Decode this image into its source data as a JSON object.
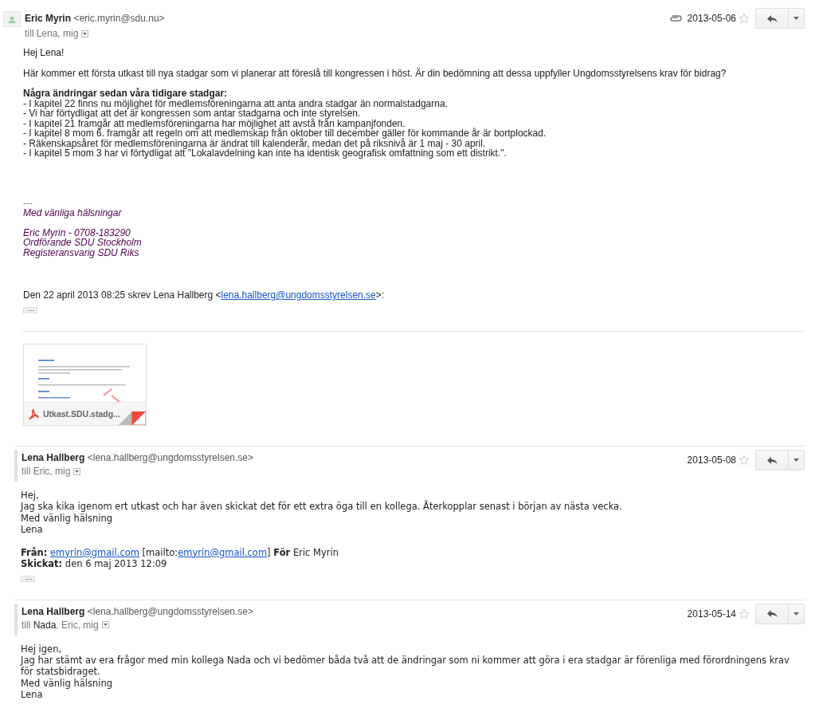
{
  "messages": [
    {
      "avatar_loaded": true,
      "sender_name": "Eric Myrin",
      "sender_email": "<eric.myrin@sdu.nu>",
      "recipients": [
        {
          "text": "till Lena, mig",
          "dark": false
        }
      ],
      "has_attachment": true,
      "date": "2013-05-06",
      "starred": false,
      "body": [
        {
          "kind": "paragraph",
          "lines": [
            "Hej Lena!"
          ]
        },
        {
          "kind": "paragraph",
          "lines": [
            "Här kommer ett första utkast till nya stadgar som vi planerar att föreslå till kongressen i höst. Är din bedömning att dessa uppfyller Ungdomsstyrelsens krav för bidrag?"
          ]
        },
        {
          "kind": "list",
          "heading": "Några ändringar sedan våra tidigare stadgar:",
          "items": [
            "- I kapitel 22 finns nu möjlighet för medlemsföreningarna att anta andra stadgar än normalstadgarna.",
            "- Vi har förtydligat att det är kongressen som antar stadgarna och inte styrelsen.",
            "- I kapitel 21 framgår att medlemsföreningarna har möjlighet att avstå från kampanjfonden.",
            "- I kapitel 8 mom 6. framgår att regeln om att medlemskap från oktober till december gäller för kommande år är bortplockad.",
            "- Räkenskapsåret för medlemsföreningarna är ändrat till kalenderår, medan det på riksnivå är 1 maj - 30 april.",
            "- I kapitel 5 mom 3 har vi förtydligat att \"Lokalavdelning kan inte ha identisk geografisk omfattning som ett distrikt.\"."
          ]
        },
        {
          "kind": "signature",
          "dash": "---",
          "groups": [
            [
              "Med vänliga hälsningar"
            ],
            [
              "Eric Myrin - 0708-183290",
              "Ordförande SDU Stockholm",
              "Registeransvarig SDU Riks"
            ]
          ]
        },
        {
          "kind": "quote",
          "before": "Den 22 april 2013 08:25 skrev Lena Hallberg <",
          "link": "lena.hallberg@ungdomsstyrelsen.se",
          "after": ">:"
        },
        {
          "kind": "ellipsis"
        },
        {
          "kind": "rule"
        },
        {
          "kind": "attachment",
          "name": "Utkast.SDU.stadg..."
        }
      ]
    },
    {
      "avatar_loaded": false,
      "sender_name": "Lena Hallberg",
      "sender_email": "<lena.hallberg@ungdomsstyrelsen.se>",
      "recipients": [
        {
          "text": "till Eric, mig",
          "dark": false
        }
      ],
      "has_attachment": false,
      "date": "2013-05-08",
      "starred": false,
      "body": [
        {
          "kind": "plain",
          "lines": [
            "Hej,",
            "Jag ska kika igenom ert utkast och har även skickat det för ett extra öga till en kollega. Återkopplar senast i början av nästa vecka.",
            "Med vänlig hälsning",
            "Lena"
          ]
        },
        {
          "kind": "from_header",
          "label": "Från:",
          "link1": "emyrin@gmail.com",
          "mid": " [mailto:",
          "link2": "emyrin@gmail.com",
          "end": "] ",
          "for_label": "För",
          "for_name": " Eric Myrin"
        },
        {
          "kind": "sent_header",
          "label": "Skickat:",
          "value": " den 6 maj 2013 12:09"
        },
        {
          "kind": "ellipsis"
        }
      ]
    },
    {
      "avatar_loaded": false,
      "sender_name": "Lena Hallberg",
      "sender_email": "<lena.hallberg@ungdomsstyrelsen.se>",
      "recipients": [
        {
          "text": "till ",
          "dark": false
        },
        {
          "text": "Nada",
          "dark": true
        },
        {
          "text": ", Eric, mig",
          "dark": false
        }
      ],
      "has_attachment": false,
      "date": "2013-05-14",
      "starred": false,
      "body": [
        {
          "kind": "plain",
          "lines": [
            "Hej igen,",
            "Jag har stämt av era frågor med min kollega Nada och vi bedömer båda två att de ändringar som ni kommer att göra i era stadgar är förenliga med förordningens krav för statsbidraget.",
            "Med vänlig hälsning",
            "Lena"
          ]
        }
      ]
    }
  ]
}
